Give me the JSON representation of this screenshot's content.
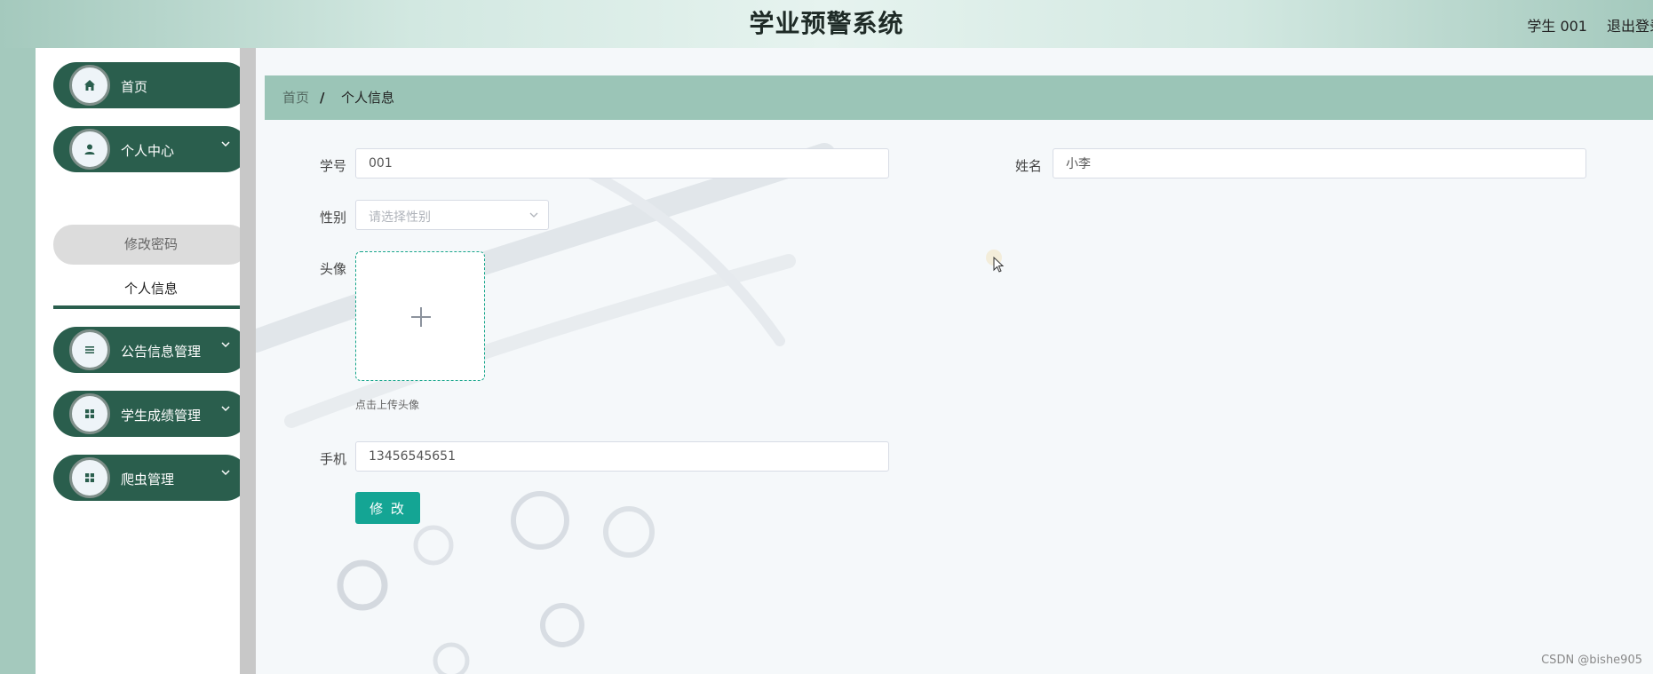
{
  "header": {
    "title": "学业预警系统",
    "user_label": "学生 001",
    "logout_label": "退出登录"
  },
  "sidebar": {
    "items": [
      {
        "label": "首页",
        "icon": "home-icon"
      },
      {
        "label": "个人中心",
        "icon": "user-icon"
      },
      {
        "label": "公告信息管理",
        "icon": "list-icon"
      },
      {
        "label": "学生成绩管理",
        "icon": "grid-icon"
      },
      {
        "label": "爬虫管理",
        "icon": "grid-icon"
      }
    ],
    "submenu": {
      "change_password": "修改密码",
      "profile": "个人信息"
    }
  },
  "breadcrumb": {
    "home": "首页",
    "separator": "/",
    "current": "个人信息"
  },
  "form": {
    "student_id_label": "学号",
    "student_id_value": "001",
    "name_label": "姓名",
    "name_value": "小李",
    "gender_label": "性别",
    "gender_placeholder": "请选择性别",
    "avatar_label": "头像",
    "avatar_tip": "点击上传头像",
    "phone_label": "手机",
    "phone_value": "13456545651",
    "submit_label": "修 改"
  },
  "watermark": "CSDN @bishe905",
  "colors": {
    "primary_dark": "#2a5e4d",
    "accent_teal": "#14a594",
    "breadcrumb_bg": "#9bc5b7"
  }
}
